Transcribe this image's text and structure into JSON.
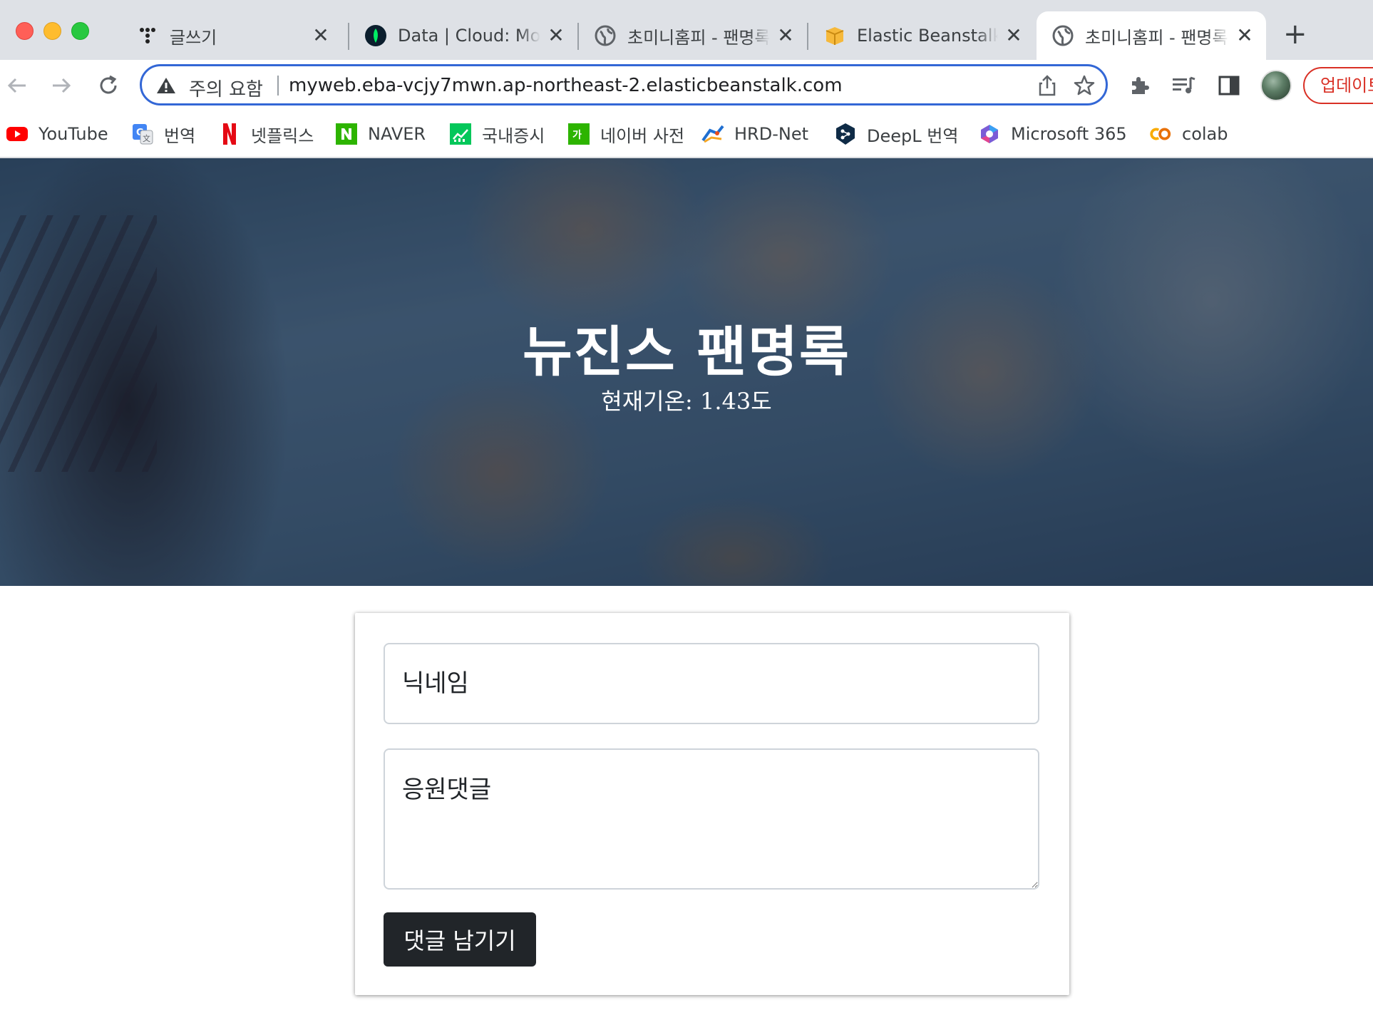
{
  "browser": {
    "tabs": [
      {
        "title": "글쓰기",
        "favicon": "dots-icon"
      },
      {
        "title": "Data | Cloud: MongoDB Cloud",
        "favicon": "mongodb-leaf-icon"
      },
      {
        "title": "초미니홈피 - 팬명록",
        "favicon": "globe-icon"
      },
      {
        "title": "Elastic Beanstalk",
        "favicon": "beanstalk-box-icon"
      },
      {
        "title": "초미니홈피 - 팬명록",
        "favicon": "globe-icon",
        "active": true
      }
    ],
    "new_tab_label": "+",
    "address": {
      "security_warning": "주의 요함",
      "url": "myweb.eba-vcjy7mwn.ap-northeast-2.elasticbeanstalk.com"
    },
    "update_label": "업데이트",
    "bookmarks": [
      {
        "label": "YouTube",
        "icon": "youtube-icon"
      },
      {
        "label": "번역",
        "icon": "google-translate-icon"
      },
      {
        "label": "넷플릭스",
        "icon": "netflix-icon"
      },
      {
        "label": "NAVER",
        "icon": "naver-icon"
      },
      {
        "label": "국내증시",
        "icon": "stock-icon"
      },
      {
        "label": "네이버 사전",
        "icon": "dictionary-icon"
      },
      {
        "label": "HRD-Net",
        "icon": "hrdnet-icon"
      },
      {
        "label": "DeepL 번역",
        "icon": "deepl-icon"
      },
      {
        "label": "Microsoft 365",
        "icon": "microsoft365-icon"
      },
      {
        "label": "colab",
        "icon": "colab-icon"
      }
    ]
  },
  "page": {
    "title": "뉴진스 팬명록",
    "temperature_label": "현재기온: ",
    "temperature_value": "1.43",
    "temperature_unit": "도",
    "form": {
      "nickname_placeholder": "닉네임",
      "comment_placeholder": "응원댓글",
      "submit_label": "댓글 남기기"
    }
  },
  "colors": {
    "omnibox_focus": "#3367d6",
    "update_red": "#d93025",
    "submit_bg": "#212529"
  }
}
